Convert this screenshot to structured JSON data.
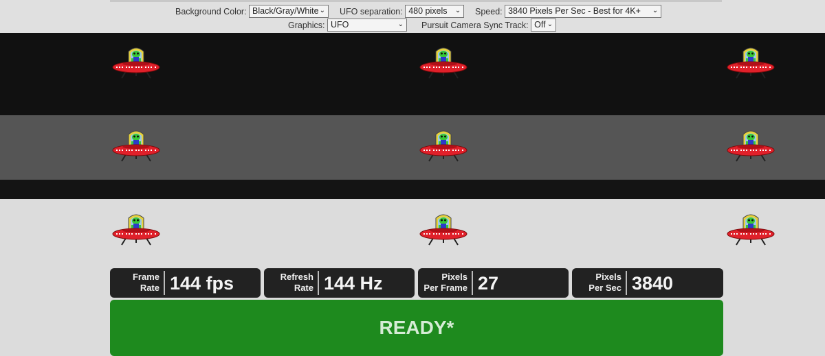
{
  "controls": {
    "background_color": {
      "label": "Background Color:",
      "value": "Black/Gray/White"
    },
    "ufo_separation": {
      "label": "UFO separation:",
      "value": "480 pixels"
    },
    "speed": {
      "label": "Speed:",
      "value": "3840 Pixels Per Sec - Best for 4K+"
    },
    "graphics": {
      "label": "Graphics:",
      "value": "UFO"
    },
    "pursuit_camera": {
      "label": "Pursuit Camera Sync Track:",
      "value": "Off"
    }
  },
  "stats": [
    {
      "label_line1": "Frame",
      "label_line2": "Rate",
      "value": "144 fps"
    },
    {
      "label_line1": "Refresh",
      "label_line2": "Rate",
      "value": "144 Hz"
    },
    {
      "label_line1": "Pixels",
      "label_line2": "Per Frame",
      "value": "27"
    },
    {
      "label_line1": "Pixels",
      "label_line2": "Per Sec",
      "value": "3840"
    }
  ],
  "status": {
    "text": "READY*"
  },
  "colors": {
    "band_black": "#111111",
    "band_gray": "#555555",
    "band_white": "#dcdcdc",
    "ready_green": "#1e8a1e",
    "stat_bg": "#222222",
    "ufo_red": "#e0202a",
    "alien_green": "#38c838",
    "dome_yellow": "#e6d23c"
  },
  "icons": {
    "ufo": "ufo-sprite-icon"
  }
}
